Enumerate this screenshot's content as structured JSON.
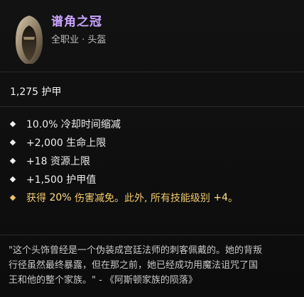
{
  "item": {
    "name": "谱角之冠",
    "subtitle": "全职业 · 头盔",
    "armor": "1,275 护甲",
    "icon": "hooded-helm-icon"
  },
  "affixes": [
    {
      "text": "10.0% 冷却时间缩减"
    },
    {
      "text": "+2,000 生命上限"
    },
    {
      "text": "+18 资源上限"
    },
    {
      "text": "+1,500 护甲值"
    }
  ],
  "legendary": {
    "part1": "获得",
    "value1": "20%",
    "part2": "伤害减免。此外, 所有技能级别",
    "value2": "+4",
    "part3": "。"
  },
  "flavor": {
    "line1": "\"这个头饰曾经是一个伪装成宫廷法师的刺客佩戴的。她的背叛",
    "line2": "行径虽然最终暴露，但在那之前，她已经成功用魔法诅咒了国",
    "line3": "王和他的整个家族。\" - 《阿斯顿家族的陨落》"
  },
  "colors": {
    "title": "#c9a3ff",
    "legendary": "#f0c96c",
    "background": "#0c0c0c"
  }
}
